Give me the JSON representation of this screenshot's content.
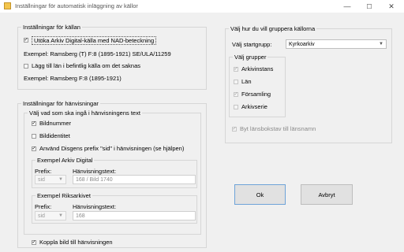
{
  "window": {
    "title": "Inställningar för automatisk inläggning av källor",
    "minimize_glyph": "—",
    "maximize_glyph": "☐",
    "close_glyph": "✕"
  },
  "source_group": {
    "legend": "Inställningar för källan",
    "extend_checkbox": {
      "label": "Utöka Arkiv Digital-källa med NAD-beteckning",
      "checked": true
    },
    "example1": "Exempel: Ramsberg (T) F:8 (1895-1921) SE/ULA/11259",
    "add_place_checkbox": {
      "label": "Lägg till län i befintlig källa om det saknas",
      "checked": false
    },
    "example2": "Exempel: Ramsberg F:8 (1895-1921)"
  },
  "reference_group": {
    "legend": "Inställningar för hänvisningar",
    "choose_group": {
      "legend": "Välj vad som ska ingå i hänvisningens text",
      "image_number": {
        "label": "Bildnummer",
        "checked": true
      },
      "image_identity": {
        "label": "Bildidentitet",
        "checked": false
      },
      "use_prefix": {
        "label": "Använd Disgens prefix \"sid\" i hänvisningen (se hjälpen)",
        "checked": true
      },
      "arkiv_digital": {
        "legend": "Exempel Arkiv Digital",
        "prefix_label": "Prefix:",
        "prefix_value": "sid",
        "ref_label": "Hänvisningstext:",
        "ref_value": "168 / Bild 1740"
      },
      "riksarkivet": {
        "legend": "Exempel Riksarkivet",
        "prefix_label": "Prefix:",
        "prefix_value": "sid",
        "ref_label": "Hänvisningstext:",
        "ref_value": "168"
      }
    },
    "link_image": {
      "label": "Koppla bild till hänvisningen",
      "checked": true
    }
  },
  "grouping": {
    "legend": "Välj hur du vill gruppera källorna",
    "start_group_label": "Välj startgrupp:",
    "start_group_value": "Kyrkoarkiv",
    "groups_legend": "Välj grupper",
    "groups": [
      {
        "label": "Arkivinstans",
        "checked": true
      },
      {
        "label": "Län",
        "checked": false
      },
      {
        "label": "Församling",
        "checked": true
      },
      {
        "label": "Arkivserie",
        "checked": false
      }
    ],
    "swap_letter": {
      "label": "Byt länsbokstav till länsnamn",
      "checked": true
    }
  },
  "buttons": {
    "ok": "Ok",
    "cancel": "Avbryt"
  },
  "colors": {
    "accent_border": "#6ea3d8",
    "disabled_text": "#8a8a8a"
  },
  "icons": {
    "checkmark": "✓",
    "dropdown": "▼"
  }
}
